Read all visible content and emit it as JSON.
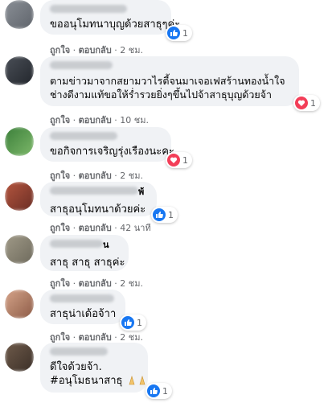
{
  "separator": "·",
  "comments": [
    {
      "text": "ขออนุโมทนาบุญด้วยสาธุๆค่ะ",
      "reaction": "like",
      "reaction_count": "1",
      "like": "ถูกใจ",
      "reply": "ตอบกลับ",
      "time": "2 ชม."
    },
    {
      "text": "ตามข่าวมาจากสยามวาไรตี้จนมาเจอเฟสร้านทองน้ำใจช่างดีงามแท้ขอให้ร่ำรวยยิ่งๆขึ้นไปจ้าสาธุบุญด้วยจ้า",
      "reaction": "love",
      "reaction_count": "1",
      "like": "ถูกใจ",
      "reply": "ตอบกลับ",
      "time": "10 ชม."
    },
    {
      "text": "ขอกิจการเจริญรุ่งเรืองนะคะ",
      "reaction": "love",
      "reaction_count": "1",
      "like": "ถูกใจ",
      "reply": "ตอบกลับ",
      "time": "2 ชม."
    },
    {
      "name_fragment": "พ้",
      "text": "สาธุอนุโมทนาด้วยค่ะ",
      "reaction": "like",
      "reaction_count": "1",
      "like": "ถูกใจ",
      "reply": "ตอบกลับ",
      "time": "42 นาที"
    },
    {
      "name_fragment": "น",
      "text": "สาธุ สาธุ สาธุค่ะ",
      "like": "ถูกใจ",
      "reply": "ตอบกลับ",
      "time": "2 ชม."
    },
    {
      "text": "สาธุน่าเด้อจ้าา",
      "reaction": "like",
      "reaction_count": "1",
      "like": "ถูกใจ",
      "reply": "ตอบกลับ",
      "time": "2 ชม."
    },
    {
      "text": "ดีใจด้วยจ้า.",
      "text2": "#อนุโมธนาสาธุ",
      "emoji": "🙏🙏",
      "reaction": "like",
      "reaction_count": "1"
    }
  ],
  "colors": {
    "like": "#1877f2",
    "love": "#f33e58",
    "bubble": "#f0f2f5",
    "meta": "#65676b"
  },
  "icons": {
    "like": "thumbs-up-icon",
    "love": "heart-icon"
  }
}
